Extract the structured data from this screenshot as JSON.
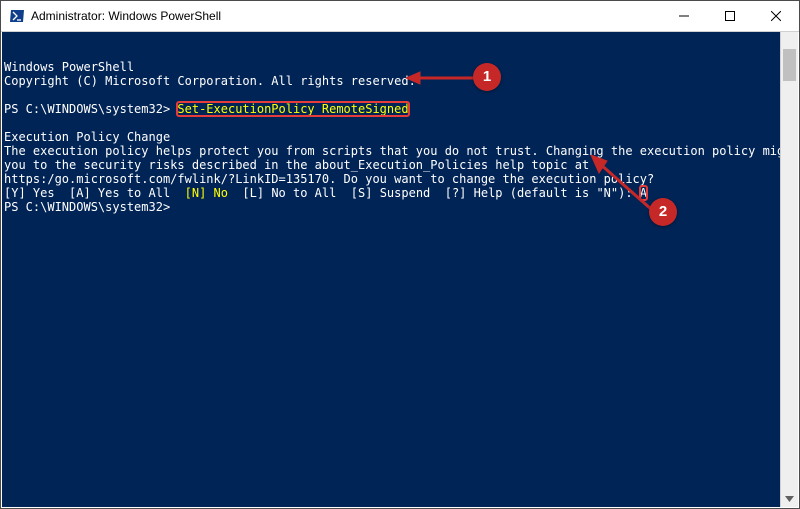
{
  "window": {
    "title": "Administrator: Windows PowerShell"
  },
  "terminal": {
    "line1": "Windows PowerShell",
    "line2": "Copyright (C) Microsoft Corporation. All rights reserved.",
    "prompt1_prefix": "PS C:\\WINDOWS\\system32> ",
    "command": "Set-ExecutionPolicy RemoteSigned",
    "policy_title": "Execution Policy Change",
    "policy_text1": "The execution policy helps protect you from scripts that you do not trust. Changing the execution policy might expose",
    "policy_text2": "you to the security risks described in the about_Execution_Policies help topic at",
    "policy_text3": "https:/go.microsoft.com/fwlink/?LinkID=135170. Do you want to change the execution policy?",
    "choices_prefix": "[Y] Yes  [A] Yes to All  ",
    "choice_no": "[N] No",
    "choices_suffix": "  [L] No to All  [S] Suspend  [?] Help (default is \"N\"): ",
    "input_answer": "A",
    "prompt2": "PS C:\\WINDOWS\\system32> "
  },
  "annot": {
    "n1": "1",
    "n2": "2"
  }
}
